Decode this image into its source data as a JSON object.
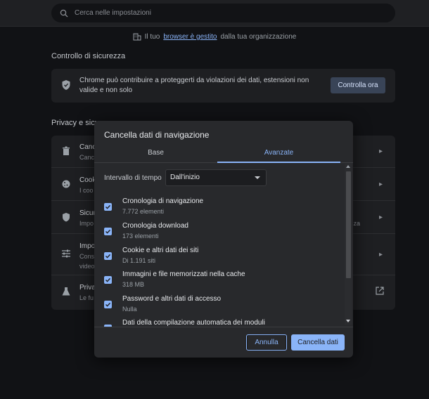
{
  "search": {
    "placeholder": "Cerca nelle impostazioni"
  },
  "managed": {
    "prefix": "Il tuo",
    "link": "browser è gestito",
    "suffix": "dalla tua organizzazione"
  },
  "safety": {
    "title": "Controllo di sicurezza",
    "text": "Chrome può contribuire a proteggerti da violazioni dei dati, estensioni non valide e non solo",
    "button": "Controlla ora"
  },
  "privacy": {
    "title": "Privacy e sicu",
    "rows": [
      {
        "t1": "Canc",
        "t2": "Canc"
      },
      {
        "t1": "Cook",
        "t2": "I coo"
      },
      {
        "t1": "Sicur",
        "t2": "Impo",
        "frag": "za"
      },
      {
        "t1": "Impo",
        "t2": "Cons",
        "t3": "video"
      },
      {
        "t1": "Priva",
        "t2": "Le fu"
      }
    ]
  },
  "dialog": {
    "title": "Cancella dati di navigazione",
    "tabs": [
      "Base",
      "Avanzate"
    ],
    "active_tab": "Avanzate",
    "range_label": "Intervallo di tempo",
    "range_value": "Dall'inizio",
    "items": [
      {
        "name": "Cronologia di navigazione",
        "detail": "7.772 elementi",
        "checked": true
      },
      {
        "name": "Cronologia download",
        "detail": "173 elementi",
        "checked": true
      },
      {
        "name": "Cookie e altri dati dei siti",
        "detail": "Di 1.191 siti",
        "checked": true
      },
      {
        "name": "Immagini e file memorizzati nella cache",
        "detail": "318 MB",
        "checked": true
      },
      {
        "name": "Password e altri dati di accesso",
        "detail": "Nulla",
        "checked": true
      },
      {
        "name": "Dati della compilazione automatica dei moduli",
        "detail": "",
        "checked": true
      }
    ],
    "cancel": "Annulla",
    "confirm": "Cancella dati"
  },
  "colors": {
    "accent": "#8ab4f8",
    "dialog_bg": "#28292c",
    "page_bg": "#111215"
  }
}
